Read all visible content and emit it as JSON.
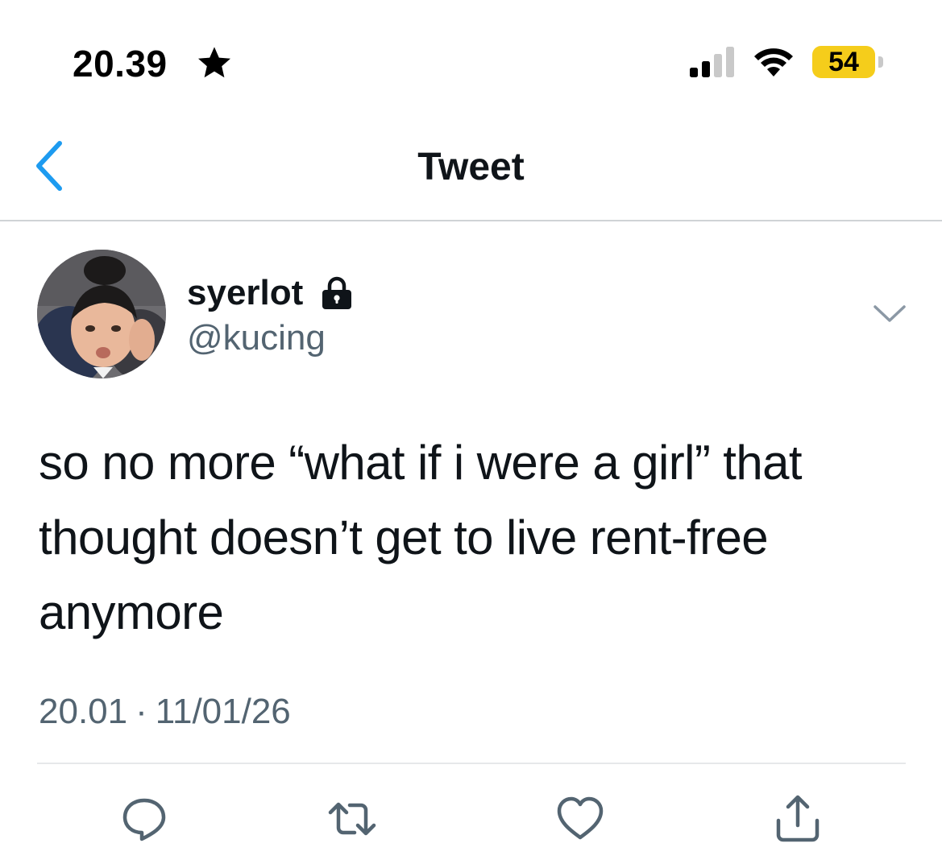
{
  "status_bar": {
    "time": "20.39",
    "battery_level": "54",
    "battery_color": "#f5cd1b",
    "icons": [
      "star-icon",
      "cellular-signal-icon",
      "wifi-icon",
      "battery-icon"
    ]
  },
  "nav": {
    "title": "Tweet",
    "back_icon": "chevron-left-icon",
    "accent_color": "#1d9bf0"
  },
  "tweet": {
    "author": {
      "display_name": "syerlot",
      "handle": "@kucing",
      "protected_icon": "lock-icon",
      "avatar": "avatar-photo"
    },
    "text": "so no more “what if i were a girl” that thought doesn’t get to live rent-free anymore",
    "time": "20.01",
    "separator": "·",
    "date": "11/01/26",
    "more_icon": "chevron-down-icon"
  },
  "actions": [
    {
      "name": "reply",
      "icon": "reply-icon"
    },
    {
      "name": "retweet",
      "icon": "retweet-icon"
    },
    {
      "name": "like",
      "icon": "heart-icon"
    },
    {
      "name": "share",
      "icon": "share-icon"
    }
  ],
  "colors": {
    "text_primary": "#0f1419",
    "text_secondary": "#536471",
    "icon_gray": "#536471"
  }
}
